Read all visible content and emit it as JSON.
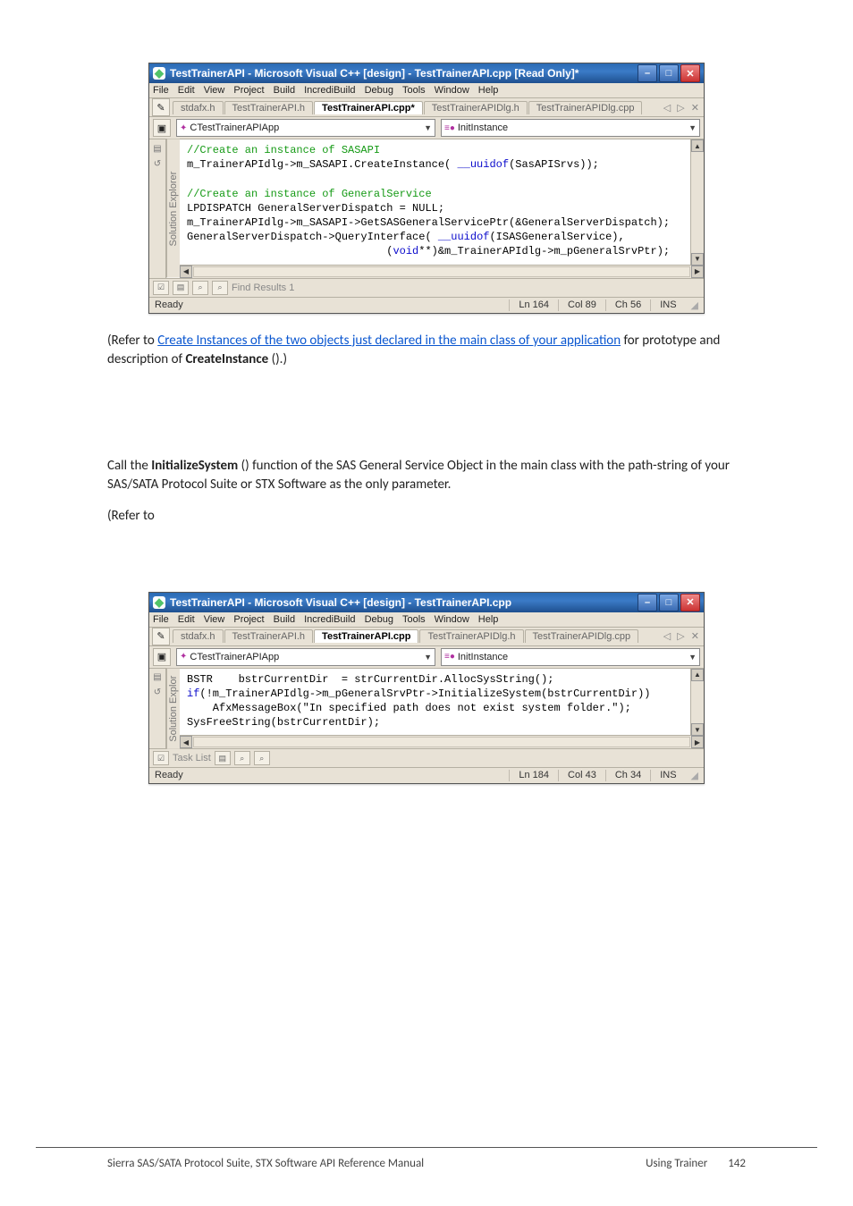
{
  "shot1": {
    "title": "TestTrainerAPI - Microsoft Visual C++ [design] - TestTrainerAPI.cpp [Read Only]*",
    "menus": [
      "File",
      "Edit",
      "View",
      "Project",
      "Build",
      "IncrediBuild",
      "Debug",
      "Tools",
      "Window",
      "Help"
    ],
    "tabs": [
      "stdafx.h",
      "TestTrainerAPI.h",
      "TestTrainerAPI.cpp*",
      "TestTrainerAPIDlg.h",
      "TestTrainerAPIDlg.cpp"
    ],
    "active_tab_index": 2,
    "tab_ctrls": "◁ ▷ ✕",
    "class_combo": "CTestTrainerAPIApp",
    "method_combo": "InitInstance",
    "explorer_label": "Solution Explorer",
    "code": {
      "l1_cm": "//Create an instance of SASAPI",
      "l2a": "m_TrainerAPIdlg->m_SASAPI.CreateInstance( ",
      "l2b_kw": "__uuidof",
      "l2c": "(SasAPISrvs));",
      "l3": "",
      "l4_cm": "//Create an instance of GeneralService",
      "l5": "LPDISPATCH GeneralServerDispatch = NULL;",
      "l6": "m_TrainerAPIdlg->m_SASAPI->GetSASGeneralServicePtr(&GeneralServerDispatch);",
      "l7a": "GeneralServerDispatch->QueryInterface( ",
      "l7b_kw": "__uuidof",
      "l7c": "(ISASGeneralService),",
      "l8a": "                               (",
      "l8b_kw": "void",
      "l8c": "**)&m_TrainerAPIdlg->m_pGeneralSrvPtr);"
    },
    "bottom_tab": "Find Results 1",
    "status": {
      "ready": "Ready",
      "ln": "Ln 164",
      "col": "Col 89",
      "ch": "Ch 56",
      "ins": "INS"
    }
  },
  "para1_pre": "(Refer to ",
  "para1_link": "Create Instances of the two objects just declared in the main class of your application",
  "para1_post": " for prototype and description of ",
  "para1_bold": "CreateInstance",
  "para1_tail": " ().)",
  "para2_a": "Call the ",
  "para2_bold": "InitializeSystem",
  "para2_b": " () function of the SAS General Service Object in the main class with the path-string of your SAS/SATA Protocol Suite or STX Software as the only parameter.",
  "para3": "(Refer to",
  "shot2": {
    "title": "TestTrainerAPI - Microsoft Visual C++ [design] - TestTrainerAPI.cpp",
    "menus": [
      "File",
      "Edit",
      "View",
      "Project",
      "Build",
      "IncrediBuild",
      "Debug",
      "Tools",
      "Window",
      "Help"
    ],
    "tabs": [
      "stdafx.h",
      "TestTrainerAPI.h",
      "TestTrainerAPI.cpp",
      "TestTrainerAPIDlg.h",
      "TestTrainerAPIDlg.cpp"
    ],
    "active_tab_index": 2,
    "tab_ctrls": "◁ ▷ ✕",
    "class_combo": "CTestTrainerAPIApp",
    "method_combo": "InitInstance",
    "explorer_label": "Solution Explor",
    "code": {
      "l1": "BSTR    bstrCurrentDir  = strCurrentDir.AllocSysString();",
      "l2a_kw": "if",
      "l2b": "(!m_TrainerAPIdlg->m_pGeneralSrvPtr->InitializeSystem(bstrCurrentDir))",
      "l3": "    AfxMessageBox(\"In specified path does not exist system folder.\");",
      "l4": "SysFreeString(bstrCurrentDir);"
    },
    "bottom_tab": "Task List",
    "status": {
      "ready": "Ready",
      "ln": "Ln 184",
      "col": "Col 43",
      "ch": "Ch 34",
      "ins": "INS"
    }
  },
  "footer": {
    "left": "Sierra SAS/SATA Protocol Suite, STX Software API Reference Manual",
    "section": "Using Trainer",
    "page": "142"
  }
}
